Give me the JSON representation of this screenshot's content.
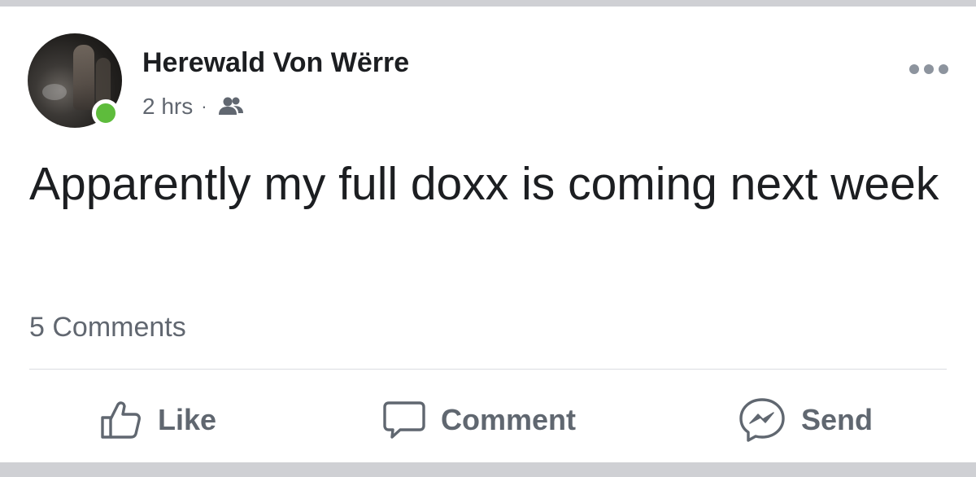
{
  "post": {
    "author": "Herewald Von Wërre",
    "timestamp": "2 hrs",
    "separator": "·",
    "audience_icon": "friends-icon",
    "online": true,
    "text": "Apparently my full doxx is coming next week",
    "comment_count": "5 Comments"
  },
  "actions": {
    "like_label": "Like",
    "comment_label": "Comment",
    "send_label": "Send"
  },
  "colors": {
    "online": "#5ebc3c",
    "text_primary": "#1c1e21",
    "text_secondary": "#606770",
    "divider": "#cfd0d4"
  }
}
